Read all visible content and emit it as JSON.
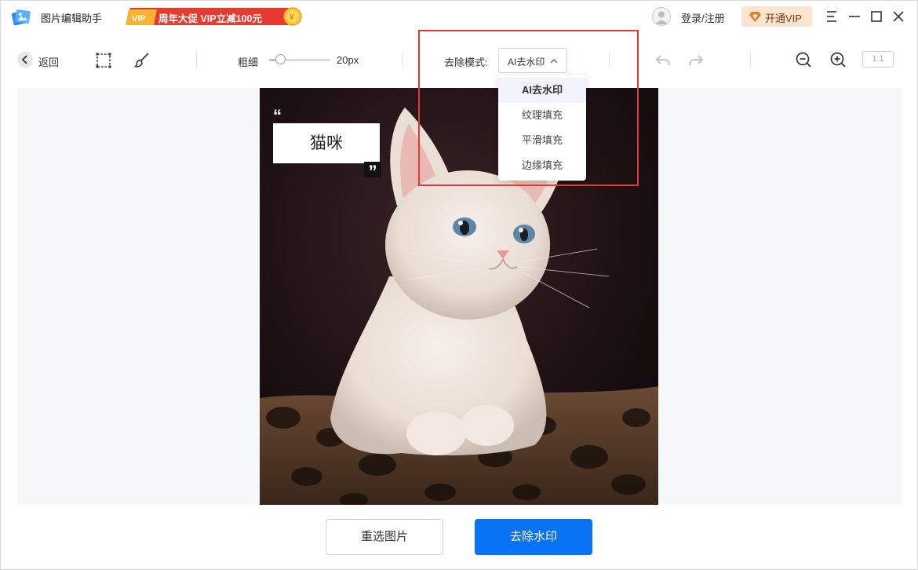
{
  "app": {
    "title": "图片编辑助手"
  },
  "promo": {
    "text": "周年大促 VIP立减100元",
    "badge": "VIP"
  },
  "account": {
    "login": "登录/注册",
    "vip_button": "开通VIP"
  },
  "toolbar": {
    "back": "返回",
    "thickness_label": "粗细",
    "thickness_value": "20px",
    "thickness_level": 0.18,
    "mode_label": "去除模式:",
    "mode_value": "AI去水印",
    "ratio": "1:1"
  },
  "dropdown": {
    "options": [
      "AI去水印",
      "纹理填充",
      "平滑填充",
      "边缘填充"
    ],
    "selected": "AI去水印"
  },
  "image": {
    "watermark_text": "猫咪",
    "quote_open": "“",
    "quote_close": "”"
  },
  "actions": {
    "reselect": "重选图片",
    "remove": "去除水印"
  },
  "colors": {
    "primary": "#0a72f5",
    "highlight": "#e53935",
    "promo": "#e63b2e",
    "vip_bg": "#fbe5d0"
  },
  "icons": [
    "app-logo-icon",
    "crown-icon",
    "coin-icon",
    "user-avatar-icon",
    "diamond-icon",
    "menu-icon",
    "minimize-icon",
    "maximize-icon",
    "close-icon",
    "back-chevron-icon",
    "rect-select-icon",
    "brush-icon",
    "chevron-up-icon",
    "undo-icon",
    "redo-icon",
    "zoom-out-icon",
    "zoom-in-icon"
  ]
}
